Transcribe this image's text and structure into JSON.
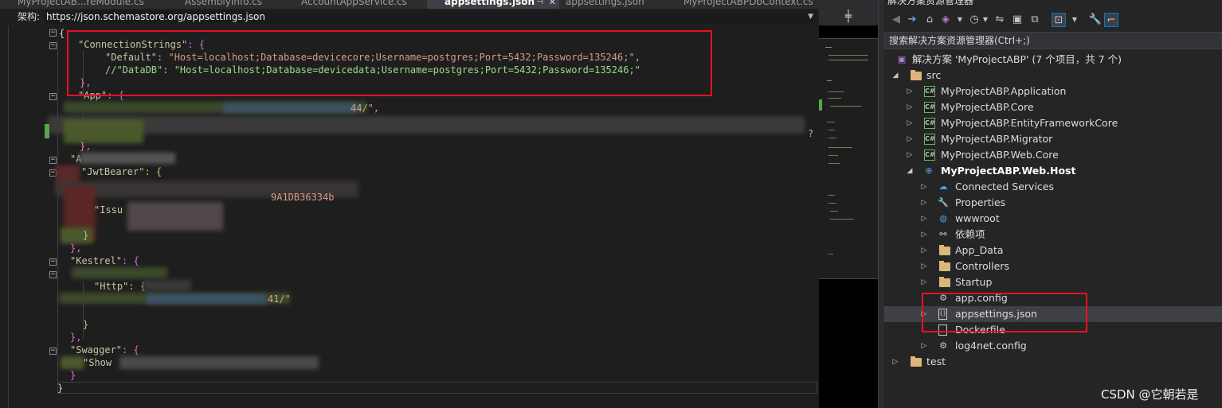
{
  "tabs": [
    {
      "label": "MyProjectAB...reModule.cs",
      "active": false
    },
    {
      "label": "AssemblyInfo.cs",
      "active": false
    },
    {
      "label": "AccountAppService.cs",
      "active": false
    },
    {
      "label": "appsettings.json",
      "active": true
    },
    {
      "label": "appsettings.json",
      "active": false
    },
    {
      "label": "MyProjectABPDbContext.cs",
      "active": false
    }
  ],
  "schema": {
    "label": "架构:",
    "url": "https://json.schemastore.org/appsettings.json"
  },
  "editor": {
    "lines": {
      "l1": "{",
      "l2_key": "\"ConnectionStrings\"",
      "l2_rest": ": {",
      "l3_key": "\"Default\"",
      "l3_val": "\"Host=localhost;Database=devicecore;Username=postgres;Port=5432;Password=135246;\"",
      "l4_key": "//\"DataDB\"",
      "l4_val": "\"Host=localhost;Database=devicedata;Username=postgres;Port=5432;Password=135246;\"",
      "l5": "},",
      "l6_key": "\"App\"",
      "l6_rest": ": {",
      "l7_tail": "44/\",",
      "l8_tail": "?",
      "l9": "},",
      "l10_key": "\"A",
      "l11_key": "\"JwtBearer\"",
      "l11_rest": ": {",
      "l12_tail": "9A1DB36334b",
      "l13_key": "\"Issu",
      "l14": "}",
      "l15": "},",
      "l16_key": "\"Kestrel\"",
      "l16_rest": ": {",
      "l17_key": "\"Http\"",
      "l17_rest": ": {",
      "l18_tail": "41/\"",
      "l19": "}",
      "l20": "},",
      "l21_key": "\"Swagger\"",
      "l21_rest": ": {",
      "l22_key": "\"Show",
      "l23": "}",
      "l24": "}"
    }
  },
  "solution_explorer": {
    "title": "解决方案资源管理器",
    "search_placeholder": "搜索解决方案资源管理器(Ctrl+;)",
    "tree": [
      {
        "label": "解决方案 'MyProjectABP' (7 个项目，共 7 个)",
        "icon": "solution-icon"
      },
      {
        "label": "src",
        "icon": "folder-icon",
        "expanded": true
      },
      {
        "label": "MyProjectABP.Application",
        "icon": "csharp-project-icon"
      },
      {
        "label": "MyProjectABP.Core",
        "icon": "csharp-project-icon"
      },
      {
        "label": "MyProjectABP.EntityFrameworkCore",
        "icon": "csharp-project-icon"
      },
      {
        "label": "MyProjectABP.Migrator",
        "icon": "csharp-project-icon"
      },
      {
        "label": "MyProjectABP.Web.Core",
        "icon": "csharp-project-icon"
      },
      {
        "label": "MyProjectABP.Web.Host",
        "icon": "web-project-icon",
        "expanded": true,
        "bold": true
      },
      {
        "label": "Connected Services",
        "icon": "connected-services-icon"
      },
      {
        "label": "Properties",
        "icon": "properties-icon"
      },
      {
        "label": "wwwroot",
        "icon": "globe-icon"
      },
      {
        "label": "依赖项",
        "icon": "dependencies-icon"
      },
      {
        "label": "App_Data",
        "icon": "folder-icon"
      },
      {
        "label": "Controllers",
        "icon": "folder-icon"
      },
      {
        "label": "Startup",
        "icon": "folder-icon"
      },
      {
        "label": "app.config",
        "icon": "config-file-icon"
      },
      {
        "label": "appsettings.json",
        "icon": "json-file-icon",
        "selected": true
      },
      {
        "label": "Dockerfile",
        "icon": "file-icon"
      },
      {
        "label": "log4net.config",
        "icon": "config-file-icon"
      },
      {
        "label": "test",
        "icon": "folder-icon"
      }
    ]
  },
  "watermark": "CSDN @它朝若是",
  "colors": {
    "highlight_box": "#e81123",
    "json_key": "#c7c5a8",
    "json_string": "#d69d85",
    "comment_green": "#9cdc8c"
  }
}
